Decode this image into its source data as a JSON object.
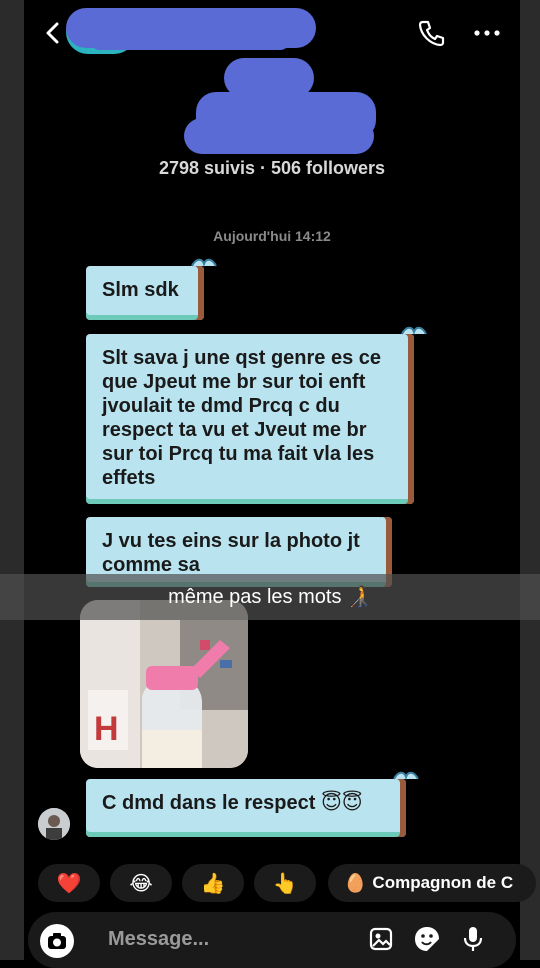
{
  "header": {
    "back_icon": "chevron-left-icon",
    "call_icon": "phone-icon",
    "more_icon": "more-horizontal-icon"
  },
  "profile": {
    "stats": "2798 suivis · 506 followers"
  },
  "thread": {
    "timestamp": "Aujourd'hui 14:12",
    "messages": [
      "Slm sdk",
      "Slt sava j une qst genre es ce que Jpeut me br sur toi enft jvoulait te dmd Prcq c du respect ta vu et Jveut me br sur toi Prcq tu ma fait vla les effets",
      "J vu tes eins sur la photo jt comme sa",
      "C dmd dans le respect 😇😇"
    ]
  },
  "overlay": {
    "caption": "même pas les mots 🧑‍🦯"
  },
  "reactions": [
    {
      "emoji": "❤️"
    },
    {
      "emoji": "😂"
    },
    {
      "emoji": "👍"
    },
    {
      "emoji": "👆"
    },
    {
      "emoji": "🥚",
      "label": "Compagnon de C"
    }
  ],
  "composer": {
    "placeholder": "Message..."
  },
  "colors": {
    "bubble": "#b9e3ef",
    "bubble_edge": "#9a5a3c",
    "redaction": "#5b6bd6"
  }
}
